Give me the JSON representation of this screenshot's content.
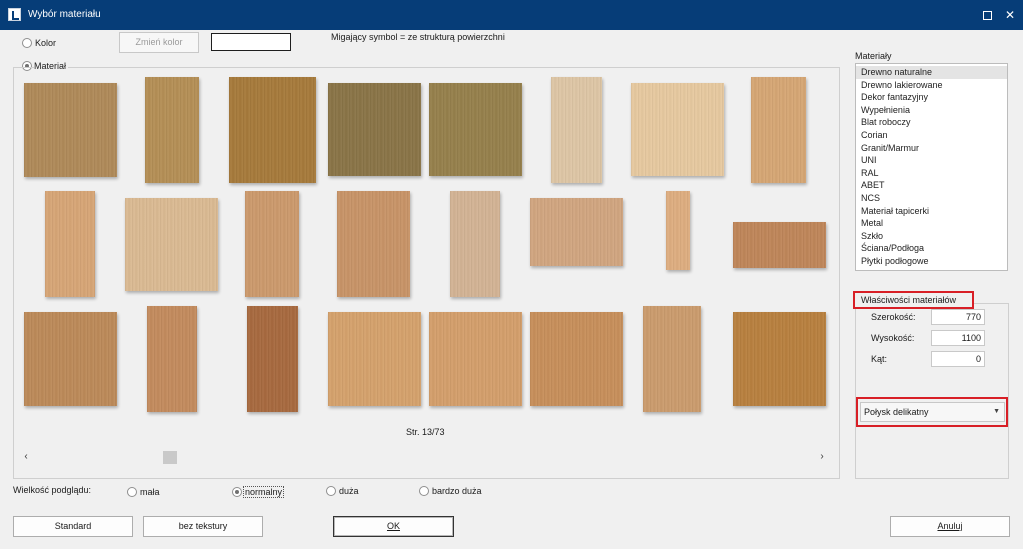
{
  "window": {
    "title": "Wybór materiału"
  },
  "top": {
    "radio_kolor": "Kolor",
    "change_color_button": "Zmień kolor",
    "hint": "Migający symbol = ze strukturą powierzchni",
    "radio_material": "Materiał"
  },
  "gallery": {
    "page_label": "Str. 13/73",
    "swatch_colors": [
      "#b08a58",
      "#b58f55",
      "#a77a3a",
      "#8a7446",
      "#96804b",
      "#dfc7a6",
      "#e8caa0",
      "#d7a774",
      "#d8a676",
      "#dcbb93",
      "#cd9a6c",
      "#c99467",
      "#d4b495",
      "#d2a680",
      "#dfae80",
      "#c08659",
      "#bd8a58",
      "#c48b5d",
      "#a8693e",
      "#d6a26c",
      "#d59f6b",
      "#c88f5a",
      "#cc9c6d",
      "#b9803e"
    ]
  },
  "materials_panel": {
    "header": "Materiały",
    "items": [
      "Drewno naturalne",
      "Drewno lakierowane",
      "Dekor fantazyjny",
      "Wypełnienia",
      "Blat roboczy",
      "Corian",
      "Granit/Marmur",
      "UNI",
      "RAL",
      "ABET",
      "NCS",
      "Materiał tapicerki",
      "Metal",
      "Szkło",
      "Ściana/Podłoga",
      "Płytki podłogowe"
    ],
    "selected_index": 0
  },
  "properties": {
    "title": "Właściwości materiałów",
    "width_label": "Szerokość:",
    "width_value": "770",
    "height_label": "Wysokość:",
    "height_value": "1100",
    "angle_label": "Kąt:",
    "angle_value": "0",
    "gloss_value": "Połysk delikatny"
  },
  "preview_size": {
    "label": "Wielkość podglądu:",
    "options": [
      "mała",
      "normalny",
      "duża",
      "bardzo duża"
    ],
    "selected": "normalny"
  },
  "buttons": {
    "standard": "Standard",
    "no_texture": "bez tekstury",
    "ok": "OK",
    "cancel": "Anuluj"
  }
}
